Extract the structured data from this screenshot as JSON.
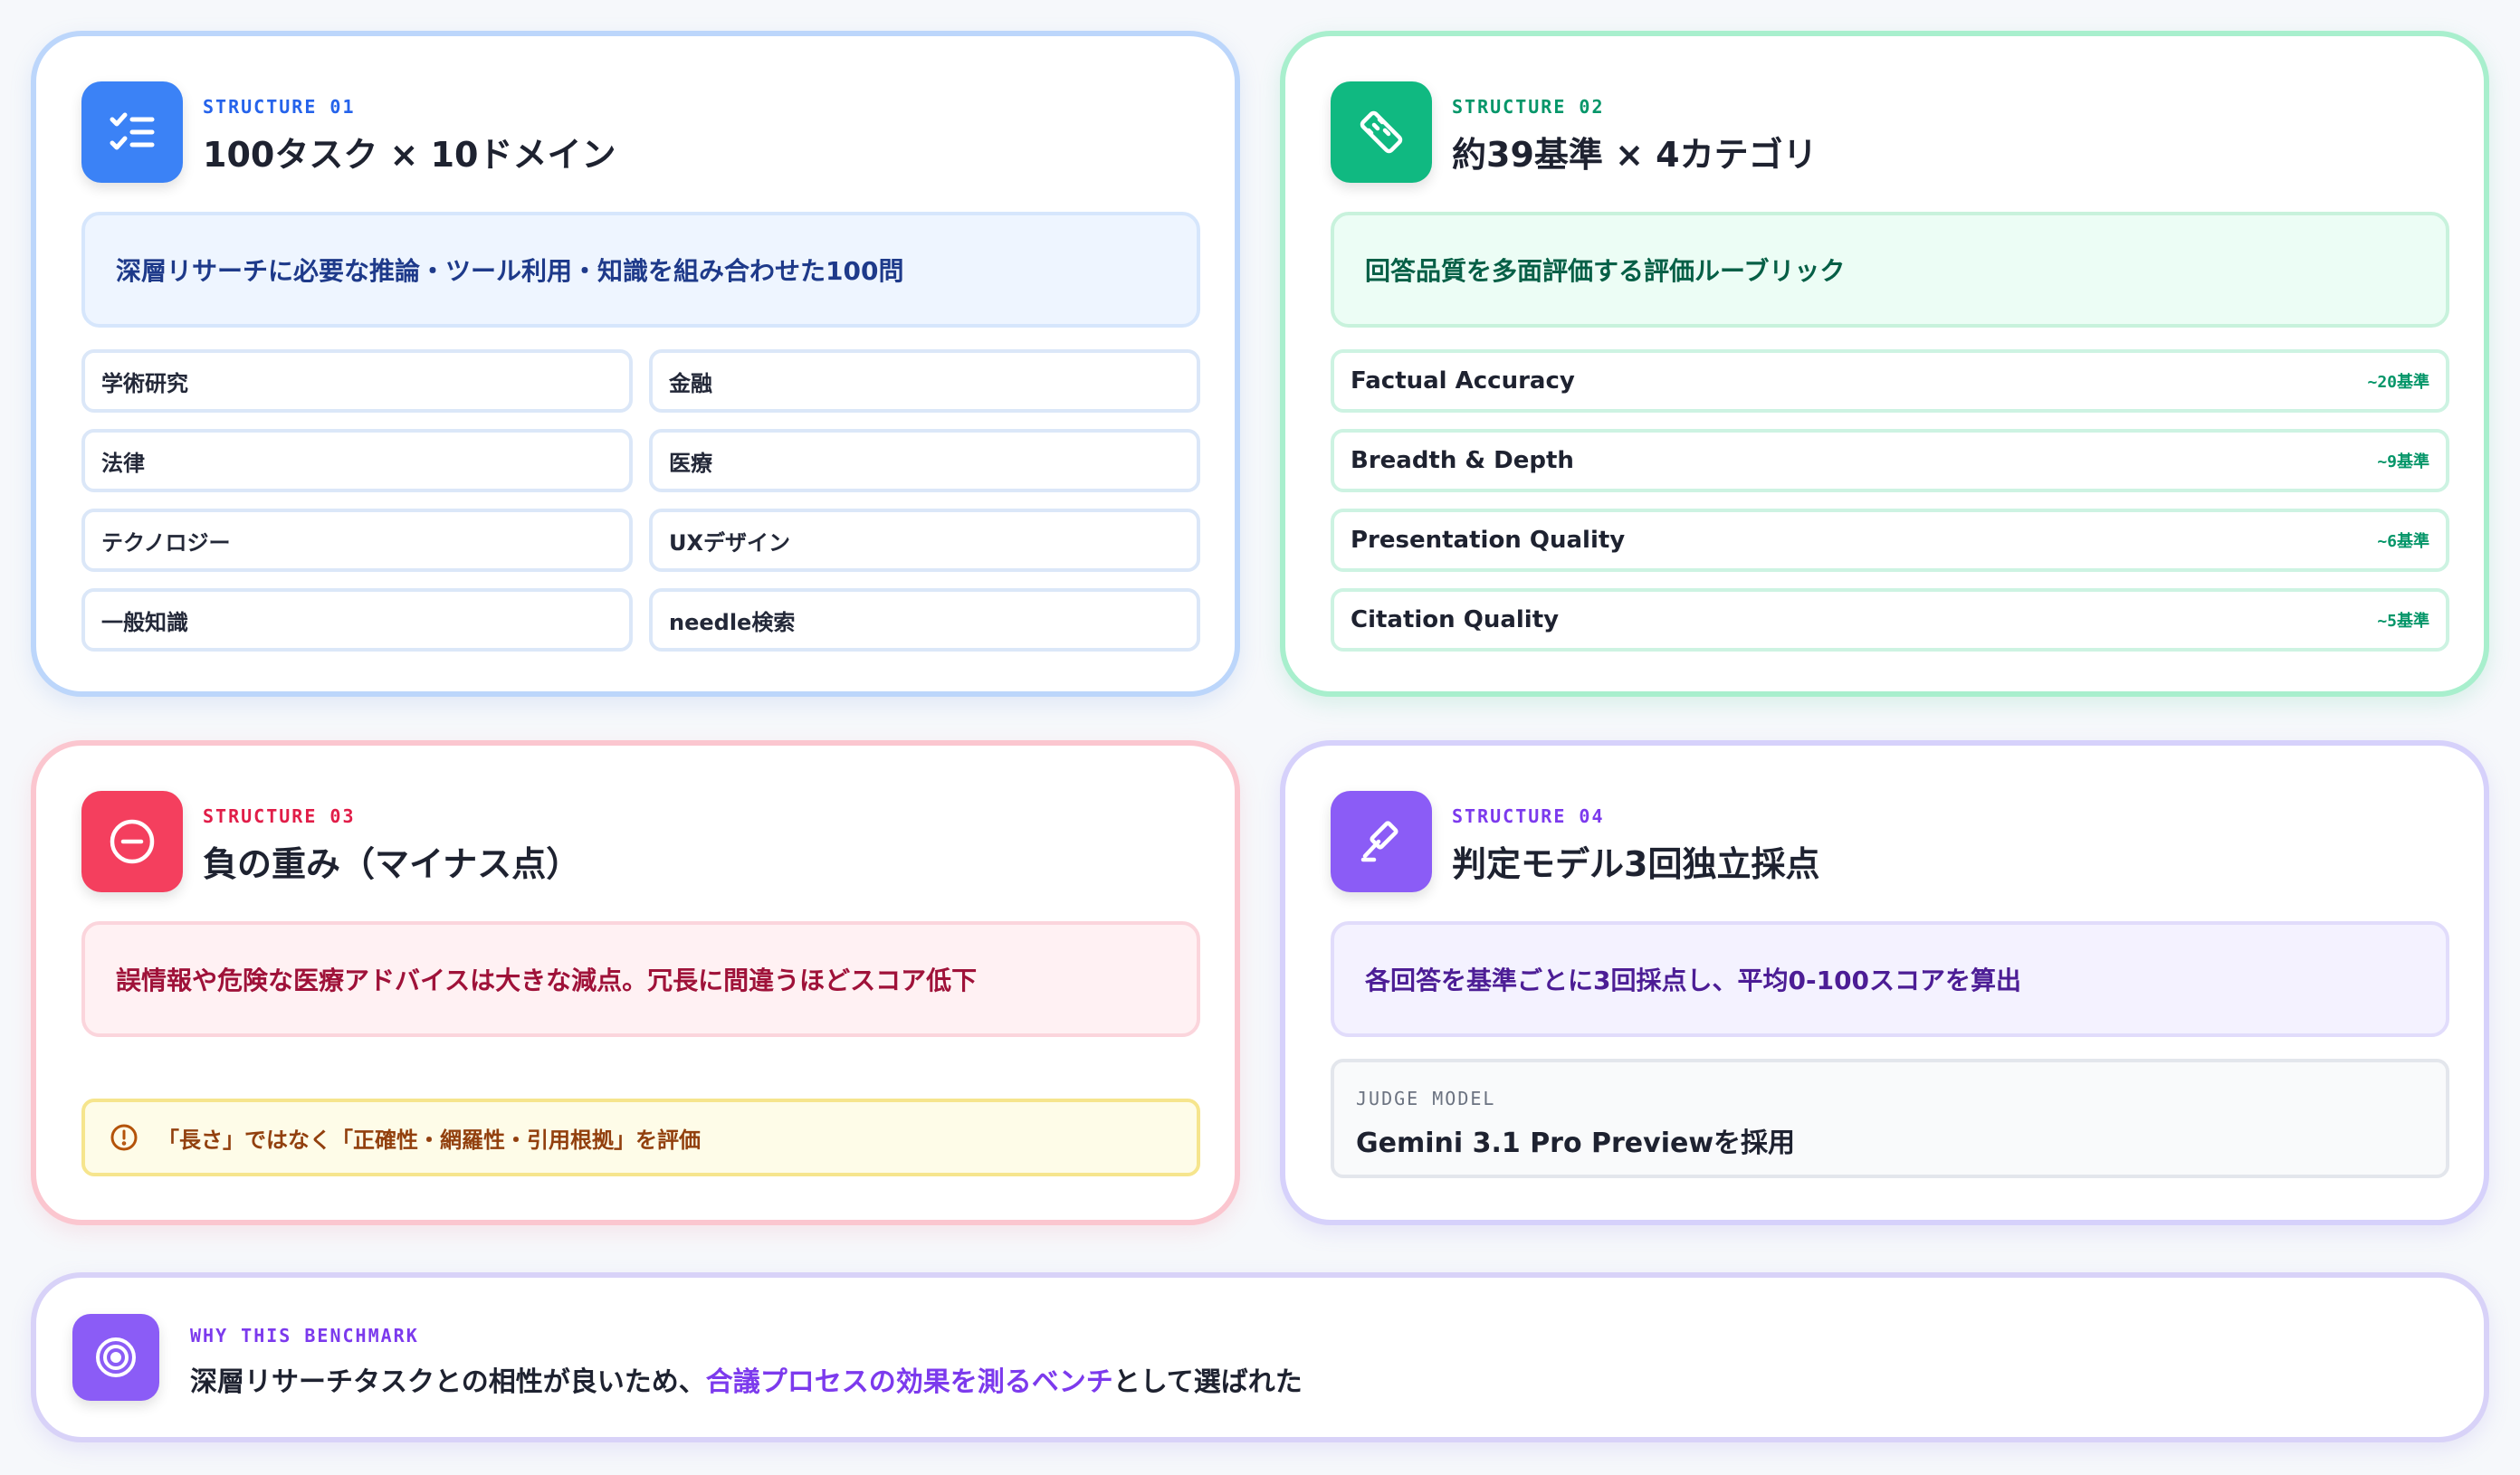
{
  "cards": {
    "tasks": {
      "eyebrow": "STRUCTURE 01",
      "title": "100タスク × 10ドメイン",
      "desc": "深層リサーチに必要な推論・ツール利用・知識を組み合わせた100問",
      "domains": [
        "学術研究",
        "金融",
        "法律",
        "医療",
        "テクノロジー",
        "UXデザイン",
        "一般知識",
        "needle検索"
      ],
      "icon": "checklist-icon",
      "color": "#3b82f6"
    },
    "rubric": {
      "eyebrow": "STRUCTURE 02",
      "title": "約39基準 × 4カテゴリ",
      "desc": "回答品質を多面評価する評価ルーブリック",
      "categories": [
        {
          "name": "Factual Accuracy",
          "count": "~20基準"
        },
        {
          "name": "Breadth & Depth",
          "count": "~9基準"
        },
        {
          "name": "Presentation Quality",
          "count": "~6基準"
        },
        {
          "name": "Citation Quality",
          "count": "~5基準"
        }
      ],
      "icon": "ruler-icon",
      "color": "#10b981"
    },
    "penalty": {
      "eyebrow": "STRUCTURE 03",
      "title": "負の重み（マイナス点）",
      "desc": "誤情報や危険な医療アドバイスは大きな減点。冗長に間違うほどスコア低下",
      "warning": "「長さ」ではなく「正確性・網羅性・引用根拠」を評価",
      "icon": "minus-circle-icon",
      "color": "#f43f5e"
    },
    "judge": {
      "eyebrow": "STRUCTURE 04",
      "title": "判定モデル3回独立採点",
      "desc": "各回答を基準ごとに3回採点し、平均0-100スコアを算出",
      "judge_label": "JUDGE MODEL",
      "judge_value": "Gemini 3.1 Pro Previewを採用",
      "icon": "gavel-icon",
      "color": "#8b5cf6"
    }
  },
  "why": {
    "eyebrow": "WHY THIS BENCHMARK",
    "sentence_pre": "深層リサーチタスクとの相性が良いため、",
    "sentence_highlight": "合議プロセスの効果を測るベンチ",
    "sentence_post": "として選ばれた",
    "icon": "target-icon",
    "color": "#8b5cf6"
  }
}
